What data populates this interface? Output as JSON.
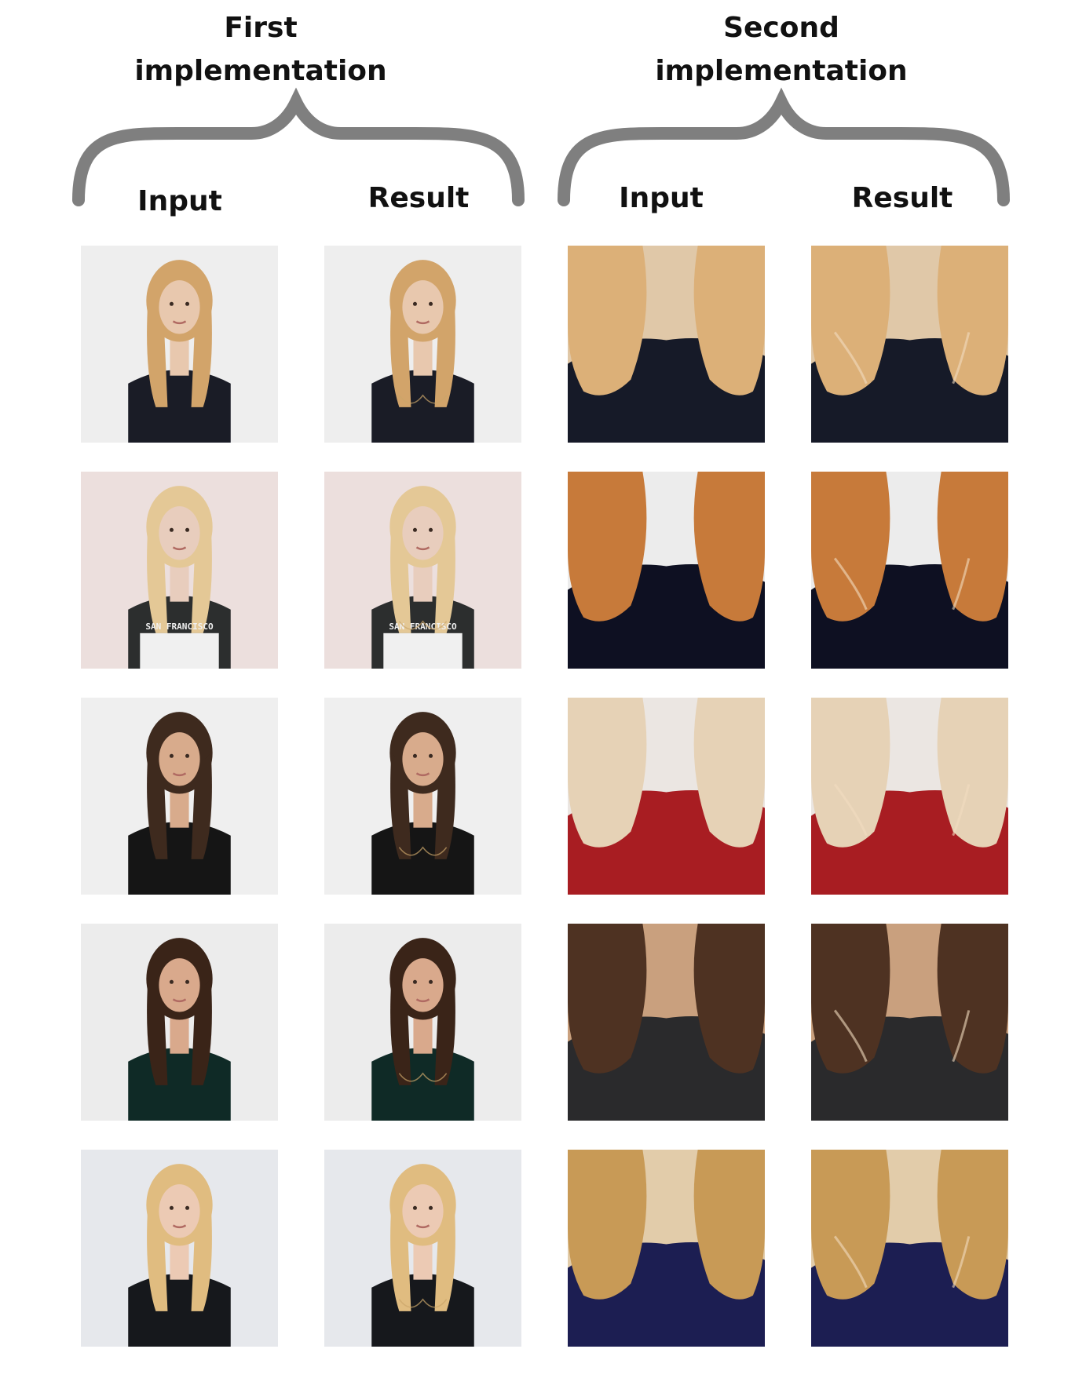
{
  "groups": [
    {
      "title_line1": "First",
      "title_line2": "implementation",
      "columns": [
        "Input",
        "Result"
      ]
    },
    {
      "title_line1": "Second",
      "title_line2": "implementation",
      "columns": [
        "Input",
        "Result"
      ]
    }
  ],
  "rows": [
    {
      "bg": "#eeeeee",
      "hair": "#d2a46a",
      "shirt": "#1a1c26",
      "skin": "#e8c8ae",
      "shirt_text": ""
    },
    {
      "bg": "#ecdfdd",
      "hair": "#e4c896",
      "shirt": "#2c2e2e",
      "skin": "#e8cdbd",
      "shirt_text": "SAN FRANCISCO"
    },
    {
      "bg": "#efefef",
      "hair": "#3e2a1e",
      "shirt": "#151515",
      "skin": "#d8ab8c",
      "shirt_text": ""
    },
    {
      "bg": "#ececec",
      "hair": "#3a2418",
      "shirt": "#0f2a26",
      "skin": "#d9a98c",
      "shirt_text": ""
    },
    {
      "bg": "#e6e8ec",
      "hair": "#e0bc80",
      "shirt": "#16181c",
      "skin": "#eccab4",
      "shirt_text": ""
    }
  ],
  "crops": [
    {
      "bg": "#e0c8a8",
      "hair": "#dcb078",
      "shirt": "#161a28"
    },
    {
      "bg": "#ececec",
      "hair": "#c77a3a",
      "shirt": "#0e1022"
    },
    {
      "bg": "#ebe6e2",
      "hair": "#e6d2b6",
      "shirt": "#a81d22"
    },
    {
      "bg": "#c9a07e",
      "hair": "#4e3222",
      "shirt": "#2a2a2c"
    },
    {
      "bg": "#e2ccaa",
      "hair": "#c89a56",
      "shirt": "#1c1e52"
    }
  ],
  "brace_color": "#7f7f7f"
}
